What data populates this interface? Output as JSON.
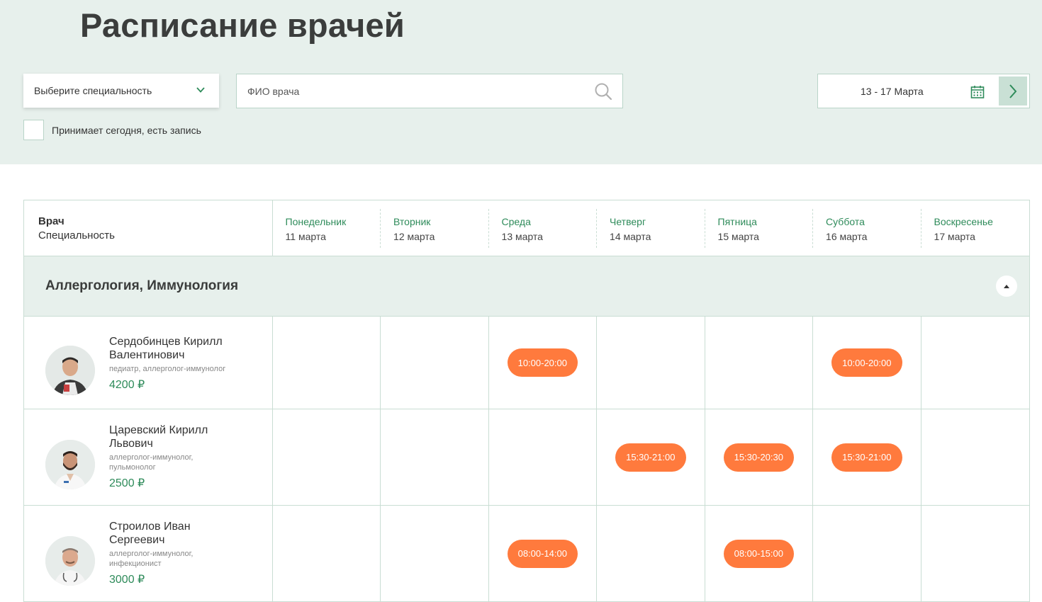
{
  "page_title": "Расписание врачей",
  "filters": {
    "specialty_select": "Выберите специальность",
    "search_placeholder": "ФИО врача",
    "date_range": "13 - 17 Марта",
    "checkbox_label": "Принимает сегодня, есть запись"
  },
  "table": {
    "header_doctor": "Врач",
    "header_specialty": "Специальность",
    "days": [
      {
        "name": "Понедельник",
        "date": "11 марта"
      },
      {
        "name": "Вторник",
        "date": "12 марта"
      },
      {
        "name": "Среда",
        "date": "13 марта"
      },
      {
        "name": "Четверг",
        "date": "14 марта"
      },
      {
        "name": "Пятница",
        "date": "15 марта"
      },
      {
        "name": "Суббота",
        "date": "16 марта"
      },
      {
        "name": "Воскресенье",
        "date": "17 марта"
      }
    ],
    "group_title": "Аллергология, Иммунология",
    "doctors": [
      {
        "name_line1": "Сердобинцев Кирилл",
        "name_line2": "Валентинович",
        "spec_line1": "педиатр, аллерголог-иммунолог",
        "spec_line2": "",
        "price": "4200 ₽",
        "slots": [
          "",
          "",
          "10:00-20:00",
          "",
          "",
          "10:00-20:00",
          ""
        ]
      },
      {
        "name_line1": "Царевский Кирилл",
        "name_line2": "Львович",
        "spec_line1": "аллерголог-иммунолог,",
        "spec_line2": "пульмонолог",
        "price": "2500 ₽",
        "slots": [
          "",
          "",
          "",
          "15:30-21:00",
          "15:30-20:30",
          "15:30-21:00",
          ""
        ]
      },
      {
        "name_line1": "Строилов Иван",
        "name_line2": "Сергеевич",
        "spec_line1": "аллерголог-иммунолог,",
        "spec_line2": "инфекционист",
        "price": "3000 ₽",
        "slots": [
          "",
          "",
          "08:00-14:00",
          "",
          "08:00-15:00",
          "",
          ""
        ]
      }
    ]
  },
  "colors": {
    "header_bg": "#e7f0ec",
    "accent_green": "#2e8b5a",
    "slot_orange": "#ff7a3d"
  }
}
